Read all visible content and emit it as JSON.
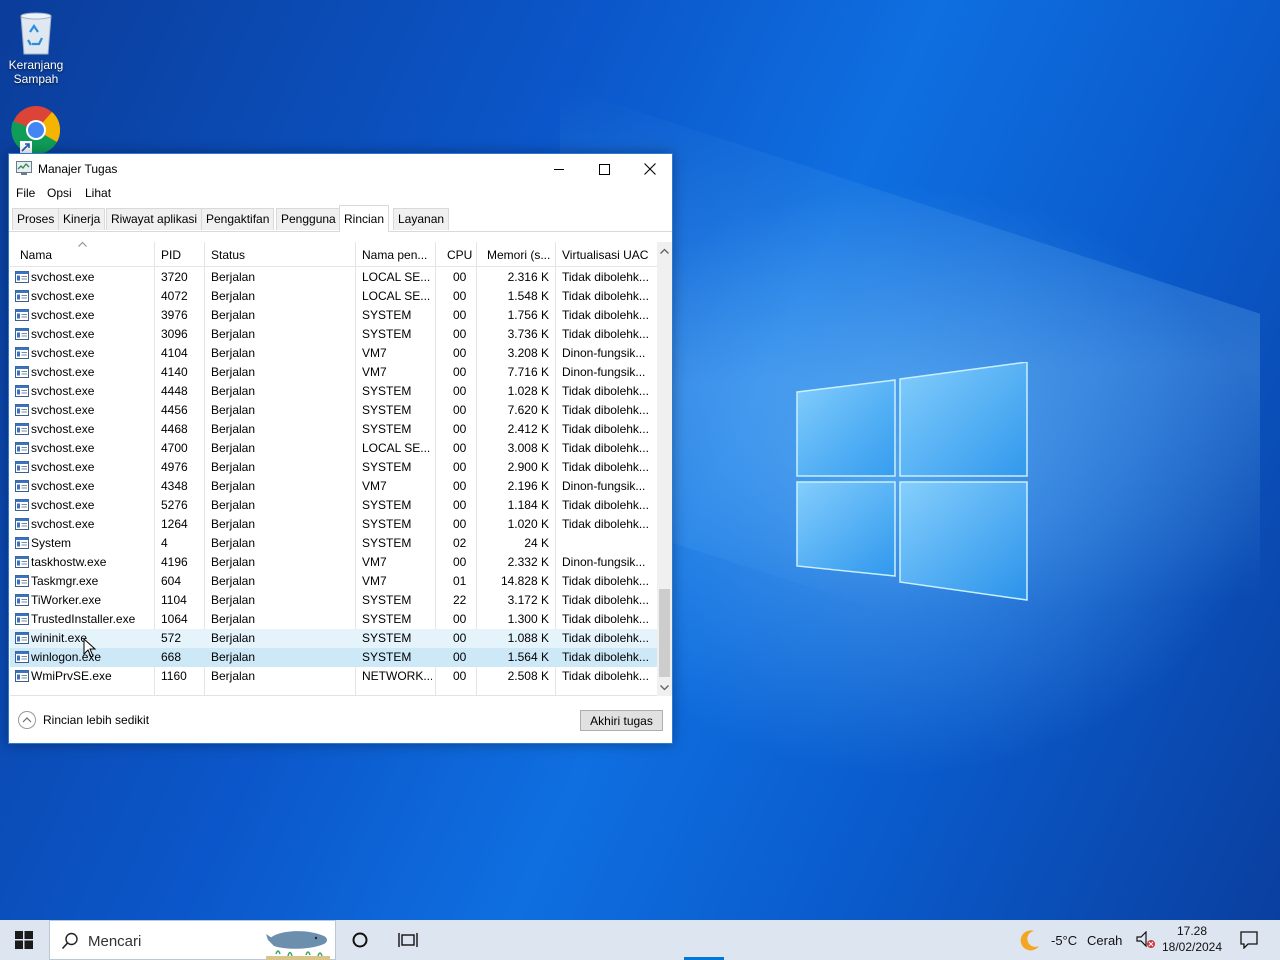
{
  "desktop": {
    "icons": [
      {
        "label_line1": "Keranjang",
        "label_line2": "Sampah"
      }
    ]
  },
  "window": {
    "title": "Manajer Tugas",
    "menu": [
      "File",
      "Opsi",
      "Lihat"
    ],
    "tabs": [
      "Proses",
      "Kinerja",
      "Riwayat aplikasi",
      "Pengaktifan",
      "Pengguna",
      "Rincian",
      "Layanan"
    ],
    "active_tab": "Rincian",
    "columns": [
      "Nama",
      "PID",
      "Status",
      "Nama pen...",
      "CPU",
      "Memori (s...",
      "Virtualisasi UAC"
    ],
    "rows": [
      {
        "name": "svchost.exe",
        "pid": "3720",
        "status": "Berjalan",
        "user": "LOCAL SE...",
        "cpu": "00",
        "mem": "2.316 K",
        "uac": "Tidak dibolehk..."
      },
      {
        "name": "svchost.exe",
        "pid": "4072",
        "status": "Berjalan",
        "user": "LOCAL SE...",
        "cpu": "00",
        "mem": "1.548 K",
        "uac": "Tidak dibolehk..."
      },
      {
        "name": "svchost.exe",
        "pid": "3976",
        "status": "Berjalan",
        "user": "SYSTEM",
        "cpu": "00",
        "mem": "1.756 K",
        "uac": "Tidak dibolehk..."
      },
      {
        "name": "svchost.exe",
        "pid": "3096",
        "status": "Berjalan",
        "user": "SYSTEM",
        "cpu": "00",
        "mem": "3.736 K",
        "uac": "Tidak dibolehk..."
      },
      {
        "name": "svchost.exe",
        "pid": "4104",
        "status": "Berjalan",
        "user": "VM7",
        "cpu": "00",
        "mem": "3.208 K",
        "uac": "Dinon-fungsik..."
      },
      {
        "name": "svchost.exe",
        "pid": "4140",
        "status": "Berjalan",
        "user": "VM7",
        "cpu": "00",
        "mem": "7.716 K",
        "uac": "Dinon-fungsik..."
      },
      {
        "name": "svchost.exe",
        "pid": "4448",
        "status": "Berjalan",
        "user": "SYSTEM",
        "cpu": "00",
        "mem": "1.028 K",
        "uac": "Tidak dibolehk..."
      },
      {
        "name": "svchost.exe",
        "pid": "4456",
        "status": "Berjalan",
        "user": "SYSTEM",
        "cpu": "00",
        "mem": "7.620 K",
        "uac": "Tidak dibolehk..."
      },
      {
        "name": "svchost.exe",
        "pid": "4468",
        "status": "Berjalan",
        "user": "SYSTEM",
        "cpu": "00",
        "mem": "2.412 K",
        "uac": "Tidak dibolehk..."
      },
      {
        "name": "svchost.exe",
        "pid": "4700",
        "status": "Berjalan",
        "user": "LOCAL SE...",
        "cpu": "00",
        "mem": "3.008 K",
        "uac": "Tidak dibolehk..."
      },
      {
        "name": "svchost.exe",
        "pid": "4976",
        "status": "Berjalan",
        "user": "SYSTEM",
        "cpu": "00",
        "mem": "2.900 K",
        "uac": "Tidak dibolehk..."
      },
      {
        "name": "svchost.exe",
        "pid": "4348",
        "status": "Berjalan",
        "user": "VM7",
        "cpu": "00",
        "mem": "2.196 K",
        "uac": "Dinon-fungsik..."
      },
      {
        "name": "svchost.exe",
        "pid": "5276",
        "status": "Berjalan",
        "user": "SYSTEM",
        "cpu": "00",
        "mem": "1.184 K",
        "uac": "Tidak dibolehk..."
      },
      {
        "name": "svchost.exe",
        "pid": "1264",
        "status": "Berjalan",
        "user": "SYSTEM",
        "cpu": "00",
        "mem": "1.020 K",
        "uac": "Tidak dibolehk..."
      },
      {
        "name": "System",
        "pid": "4",
        "status": "Berjalan",
        "user": "SYSTEM",
        "cpu": "02",
        "mem": "24 K",
        "uac": ""
      },
      {
        "name": "taskhostw.exe",
        "pid": "4196",
        "status": "Berjalan",
        "user": "VM7",
        "cpu": "00",
        "mem": "2.332 K",
        "uac": "Dinon-fungsik..."
      },
      {
        "name": "Taskmgr.exe",
        "pid": "604",
        "status": "Berjalan",
        "user": "VM7",
        "cpu": "01",
        "mem": "14.828 K",
        "uac": "Tidak dibolehk..."
      },
      {
        "name": "TiWorker.exe",
        "pid": "1104",
        "status": "Berjalan",
        "user": "SYSTEM",
        "cpu": "22",
        "mem": "3.172 K",
        "uac": "Tidak dibolehk..."
      },
      {
        "name": "TrustedInstaller.exe",
        "pid": "1064",
        "status": "Berjalan",
        "user": "SYSTEM",
        "cpu": "00",
        "mem": "1.300 K",
        "uac": "Tidak dibolehk..."
      },
      {
        "name": "wininit.exe",
        "pid": "572",
        "status": "Berjalan",
        "user": "SYSTEM",
        "cpu": "00",
        "mem": "1.088 K",
        "uac": "Tidak dibolehk..."
      },
      {
        "name": "winlogon.exe",
        "pid": "668",
        "status": "Berjalan",
        "user": "SYSTEM",
        "cpu": "00",
        "mem": "1.564 K",
        "uac": "Tidak dibolehk..."
      },
      {
        "name": "WmiPrvSE.exe",
        "pid": "1160",
        "status": "Berjalan",
        "user": "NETWORK...",
        "cpu": "00",
        "mem": "2.508 K",
        "uac": "Tidak dibolehk..."
      }
    ],
    "fewer_details": "Rincian lebih sedikit",
    "end_task": "Akhiri tugas"
  },
  "taskbar": {
    "search_placeholder": "Mencari",
    "weather_temp": "-5°C",
    "weather_desc": "Cerah",
    "time": "17.28",
    "date": "18/02/2024"
  },
  "colors": {
    "accent": "#0078d7",
    "row_hover": "#e5f3fb",
    "row_selected": "#cde8f7"
  }
}
